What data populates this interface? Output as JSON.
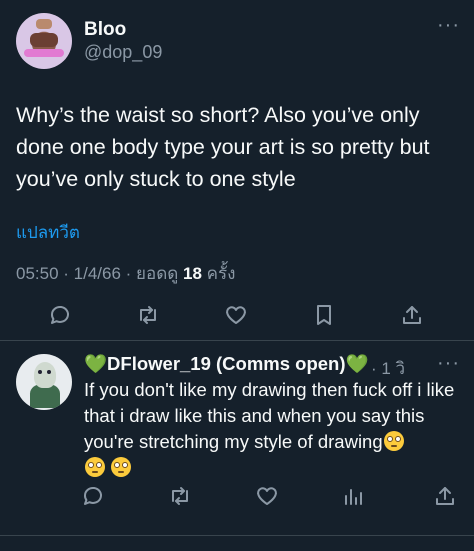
{
  "tweet": {
    "author_name": "Bloo",
    "author_handle": "@dop_09",
    "text": "Why’s the waist so short? Also you’ve only done one body type your art is so pretty but you’ve only stuck to one style",
    "translate_label": "แปลทวีต",
    "meta_prefix": "05:50 · 1/4/66 · ยอดดู",
    "views": "18",
    "meta_suffix": "ครั้ง",
    "more_label": "···"
  },
  "tweet_actions": [
    "reply-icon",
    "retweet-icon",
    "like-icon",
    "bookmark-icon",
    "share-icon"
  ],
  "reply": {
    "author_name": "💚DFlower_19 (Comms open)💚",
    "time": "· 1 วิ",
    "text": "If you don't like my drawing then fuck off i like that i draw like this and when you say this you're stretching my style of drawing",
    "more_label": "···",
    "emoji": "rolling-eyes-emoji"
  },
  "reply_actions": [
    "reply-icon",
    "retweet-icon",
    "like-icon",
    "views-icon",
    "share-icon"
  ],
  "colors": {
    "background": "#15202b",
    "text": "#f7f9f9",
    "secondary": "#8b98a5",
    "link": "#1d9bf0",
    "divider": "#38444d",
    "heart": "#3fc63f"
  }
}
